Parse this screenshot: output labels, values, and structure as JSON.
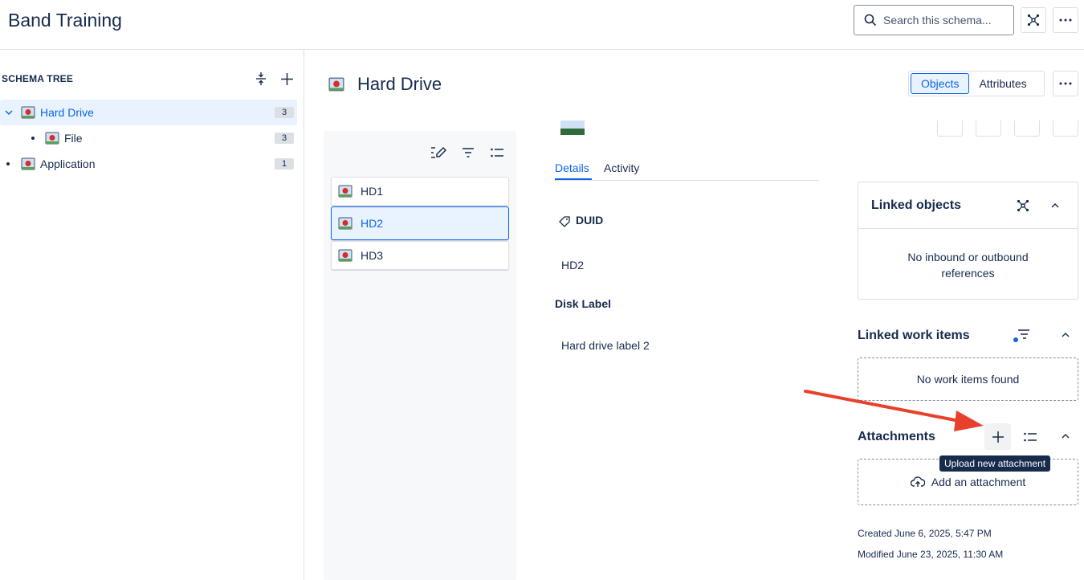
{
  "app": {
    "title": "Band Training"
  },
  "search": {
    "placeholder": "Search this schema..."
  },
  "schema_tree": {
    "heading": "SCHEMA TREE",
    "items": [
      {
        "label": "Hard Drive",
        "count": "3",
        "selected": true
      },
      {
        "label": "File",
        "count": "3"
      },
      {
        "label": "Application",
        "count": "1"
      }
    ]
  },
  "object_type": {
    "title": "Hard Drive",
    "views": {
      "objects": "Objects",
      "attributes": "Attributes"
    }
  },
  "objects_list": {
    "items": [
      {
        "label": "HD1"
      },
      {
        "label": "HD2",
        "selected": true
      },
      {
        "label": "HD3"
      }
    ]
  },
  "detail": {
    "tabs": {
      "details": "Details",
      "activity": "Activity"
    },
    "attributes": [
      {
        "label": "DUID",
        "value": "HD2"
      },
      {
        "label": "Disk Label",
        "value": "Hard drive label 2"
      }
    ]
  },
  "linked_objects": {
    "title": "Linked objects",
    "empty_text": "No inbound or outbound references"
  },
  "linked_work_items": {
    "title": "Linked work items",
    "empty_text": "No work items found"
  },
  "attachments": {
    "title": "Attachments",
    "add_label": "Add an attachment",
    "tooltip": "Upload new attachment"
  },
  "meta": {
    "created": "Created June 6, 2025, 5:47 PM",
    "modified": "Modified June 23, 2025, 11:30 AM"
  },
  "colors": {
    "accent": "#0c66e4",
    "arrow": "#e8412b",
    "border": "#dcdfe4"
  }
}
